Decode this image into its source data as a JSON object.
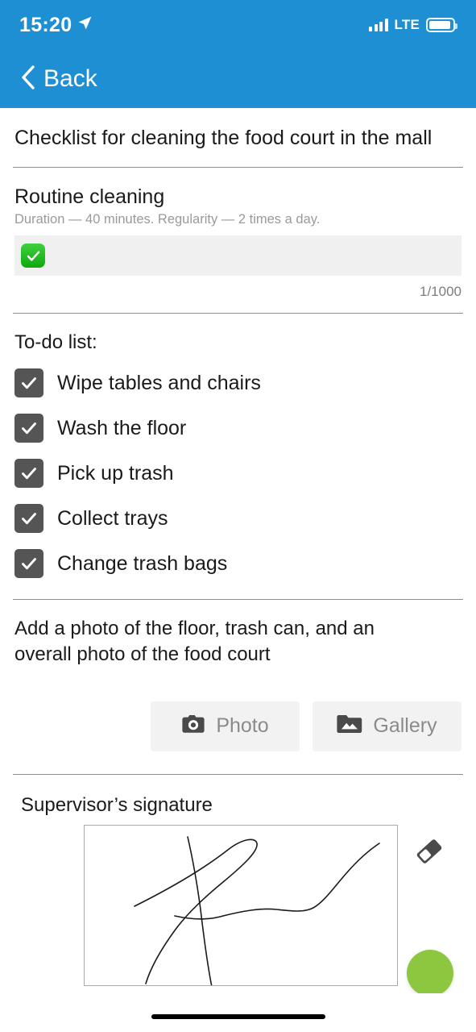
{
  "status_bar": {
    "time": "15:20",
    "location_icon": "location-arrow-icon",
    "signal_icon": "cellular-signal-icon",
    "signal_bars": 4,
    "network": "LTE",
    "battery_icon": "battery-icon",
    "battery_level": 92
  },
  "nav": {
    "back_label": "Back",
    "back_icon": "chevron-left-icon",
    "header_color": "#1d8fd2"
  },
  "document": {
    "title": "Checklist for cleaning the food court in the mall"
  },
  "task": {
    "name": "Routine cleaning",
    "meta": "Duration — 40 minutes. Regularity — 2 times a day.",
    "answer_value": "✅",
    "answer_placeholder": "",
    "char_counter": "1/1000"
  },
  "todo": {
    "heading": "To-do list:",
    "items": [
      {
        "label": "Wipe tables and chairs",
        "checked": true
      },
      {
        "label": "Wash the floor",
        "checked": true
      },
      {
        "label": "Pick up trash",
        "checked": true
      },
      {
        "label": "Collect trays",
        "checked": true
      },
      {
        "label": "Change trash bags",
        "checked": true
      }
    ]
  },
  "photo": {
    "prompt": "Add a photo of the floor, trash can, and an overall photo of the food court",
    "camera_button": {
      "label": "Photo",
      "icon": "camera-icon"
    },
    "gallery_button": {
      "label": "Gallery",
      "icon": "gallery-icon"
    }
  },
  "signature": {
    "heading": "Supervisor’s signature",
    "erase_icon": "eraser-icon",
    "has_signature": true
  },
  "fab": {
    "icon": "submit-fab",
    "color": "#8dc63f"
  },
  "colors": {
    "accent_blue": "#1d8fd2",
    "checkbox_gray": "#555555",
    "field_gray": "#f0f0f0",
    "button_gray": "#f2f2f2",
    "muted_text": "#9a9a9a"
  }
}
